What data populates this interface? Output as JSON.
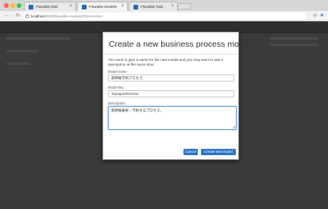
{
  "browser": {
    "tabs": [
      {
        "label": "Flowable IDM"
      },
      {
        "label": "Flowable Modeler"
      },
      {
        "label": "Flowable Task"
      }
    ],
    "url_host": "localhost",
    "url_path": ":8080/flowable-modeler/#/processes"
  },
  "modal": {
    "title": "Create a new business process model",
    "intro": "You need to give a name for the new model and you may want to add a description at the same time.",
    "model_name_label": "Model name",
    "model_name_value": "新幹線予約プロセス",
    "model_key_label": "Model key",
    "model_key_value": "TransportProcess",
    "description_label": "Description",
    "description_value": "新幹線乗車・予約するプロセス。",
    "cancel_label": "Cancel",
    "create_label": "Create new model"
  },
  "colors": {
    "primary_button": "#2e74c4"
  }
}
